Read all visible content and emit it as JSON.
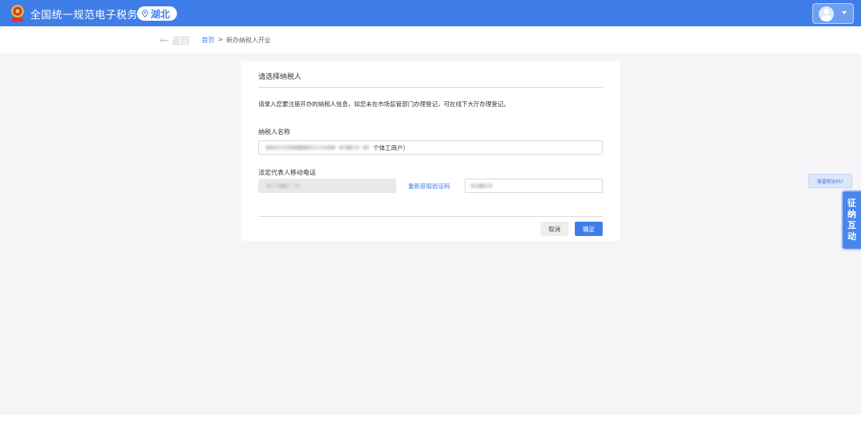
{
  "header": {
    "site_title": "全国统一规范电子税务局",
    "region": "湖北"
  },
  "nav": {
    "back_label": "返回",
    "breadcrumb": {
      "home": "首页",
      "separator": ">",
      "current": "新办纳税人开业"
    }
  },
  "form": {
    "title": "请选择纳税人",
    "hint": "请录入您要注册开办的纳税人信息，如您未在市场监管部门办理登记，可在线下大厅办理登记。",
    "taxpayer_name_label": "纳税人名称",
    "taxpayer_name_suffix": "个体工商户）",
    "phone_label": "法定代表人移动电话",
    "resend_code": "重新获取验证码",
    "cancel": "取消",
    "confirm": "确定"
  },
  "float": {
    "help": "需要帮助吗?",
    "interact": [
      "征",
      "纳",
      "互",
      "动"
    ]
  },
  "colors": {
    "brand": "#3f7ee8",
    "background": "#f5f5f7"
  },
  "icons": {
    "emblem": "tax-emblem-icon",
    "location": "location-pin-icon",
    "avatar": "user-avatar-icon",
    "dropdown": "caret-down-icon",
    "back": "arrow-left-icon"
  }
}
